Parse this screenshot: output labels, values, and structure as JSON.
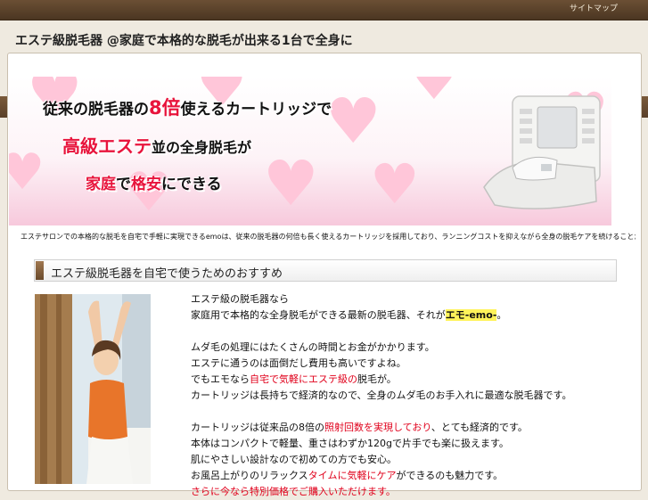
{
  "header": {
    "top_link": "サイトマップ",
    "site_title": "エステ級脱毛器 @家庭で本格的な脱毛が出来る1台で全身に"
  },
  "banner": {
    "line1_a": "従来の脱毛器の",
    "line1_hl": "8倍",
    "line1_b": "使えるカートリッジで",
    "line2_hl": "高級エステ",
    "line2_b": "並の全身脱毛が",
    "line3_hl1": "家庭",
    "line3_a": "で",
    "line3_hl2": "格安",
    "line3_b": "にできる"
  },
  "intro_text": "エステサロンでの本格的な脱毛を自宅で手軽に実現できるemoは、従来の脱毛器の何倍も長く使えるカートリッジを採用しており、ランニングコストを抑えながら全身の脱毛ケアを続けることができる家庭用脱毛器です。",
  "section": {
    "title": "エステ級脱毛器を自宅で使うためのおすすめ"
  },
  "body": {
    "p1": "エステ級の脱毛器なら",
    "p2_a": "家庭用で本格的な全身脱毛ができる最新の脱毛器、それが",
    "p2_hl": "エモ-emo-",
    "p2_b": "。",
    "p3": "ムダ毛の処理にはたくさんの時間とお金がかかります。",
    "p4": "エステに通うのは面倒だし費用も高いですよね。",
    "p5_a": "でもエモなら",
    "p5_red": "自宅で気軽にエステ級の",
    "p5_b": "脱毛が。",
    "p6": "カートリッジは長持ちで経済的なので、全身のムダ毛のお手入れに最適な脱毛器です。",
    "p7_a": "カートリッジは従来品の8倍の",
    "p7_red": "照射回数を実現しており",
    "p7_b": "、とても経済的です。",
    "p8": "本体はコンパクトで軽量、重さはわずか120gで片手でも楽に扱えます。",
    "p9": "肌にやさしい設計なので初めての方でも安心。",
    "p10_a": "お風呂上がりのリラックス",
    "p10_red": "タイムに気軽にケア",
    "p10_b": "ができるのも魅力です。",
    "p11": "さらに今なら特別価格でご購入いただけます。"
  },
  "colors": {
    "accent_red": "#e0001b",
    "highlight_yellow": "#fff35a",
    "brown": "#6b4f34"
  }
}
